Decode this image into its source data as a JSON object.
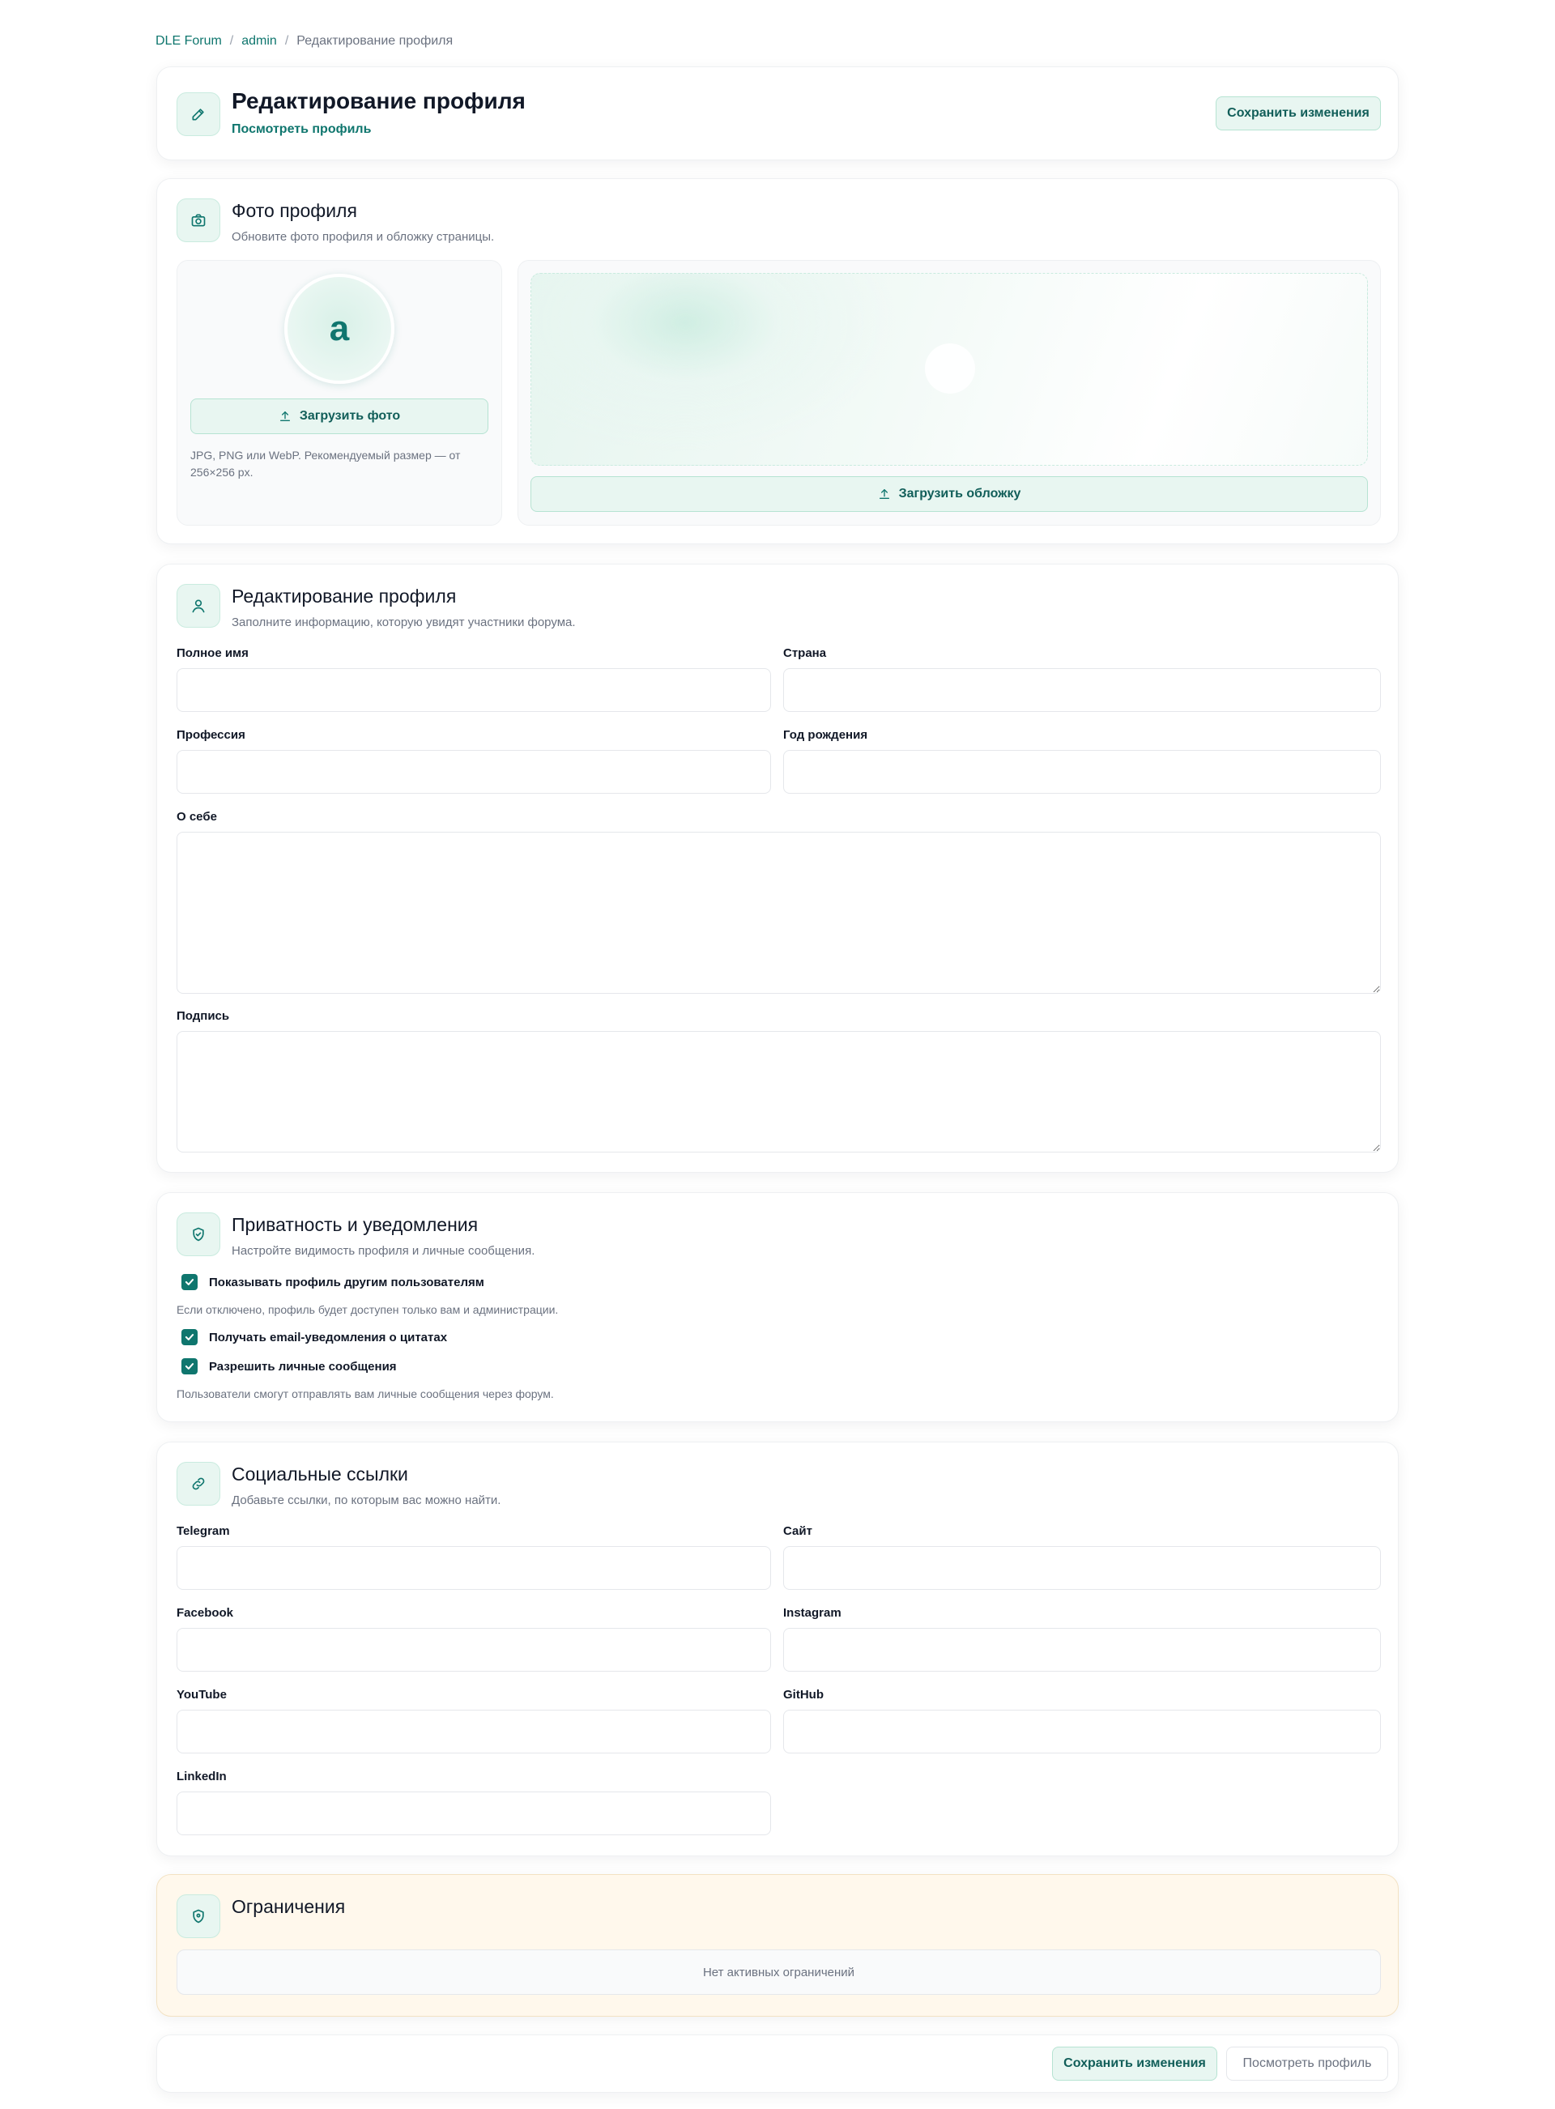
{
  "breadcrumb": {
    "items": [
      "DLE Forum",
      "admin",
      "Редактирование профиля"
    ],
    "separator": "/"
  },
  "header": {
    "title": "Редактирование профиля",
    "view_link": "Посмотреть профиль",
    "save_label": "Сохранить изменения"
  },
  "photo": {
    "title": "Фото профиля",
    "subtitle": "Обновите фото профиля и обложку страницы.",
    "avatar_letter": "a",
    "upload_photo_label": "Загрузить фото",
    "hint": "JPG, PNG или WebP. Рекомендуемый размер — от 256×256 px.",
    "upload_cover_label": "Загрузить обложку"
  },
  "profile": {
    "title": "Редактирование профиля",
    "subtitle": "Заполните информацию, которую увидят участники форума.",
    "full_name_label": "Полное имя",
    "country_label": "Страна",
    "profession_label": "Профессия",
    "birth_year_label": "Год рождения",
    "about_label": "О себе",
    "signature_label": "Подпись",
    "full_name": "",
    "country": "",
    "profession": "",
    "birth_year": "",
    "about": "",
    "signature": ""
  },
  "privacy": {
    "title": "Приватность и уведомления",
    "subtitle": "Настройте видимость профиля и личные сообщения.",
    "show_profile_label": "Показывать профиль другим пользователям",
    "show_profile_checked": true,
    "show_profile_hint": "Если отключено, профиль будет доступен только вам и администрации.",
    "email_notify_label": "Получать email-уведомления о цитатах",
    "email_notify_checked": true,
    "pm_label": "Разрешить личные сообщения",
    "pm_checked": true,
    "pm_hint": "Пользователи смогут отправлять вам личные сообщения через форум."
  },
  "social": {
    "title": "Социальные ссылки",
    "subtitle": "Добавьте ссылки, по которым вас можно найти.",
    "telegram_label": "Telegram",
    "site_label": "Сайт",
    "facebook_label": "Facebook",
    "instagram_label": "Instagram",
    "youtube_label": "YouTube",
    "github_label": "GitHub",
    "linkedin_label": "LinkedIn"
  },
  "restrictions": {
    "title": "Ограничения",
    "empty_text": "Нет активных ограничений"
  },
  "footer": {
    "save_label": "Сохранить изменения",
    "view_label": "Посмотреть профиль"
  },
  "colors": {
    "accent": "#0f766e",
    "accent_bg": "#e8f6f1",
    "warning_bg": "#fff8ec"
  },
  "icons": {
    "header": "pencil-icon",
    "photo": "camera-icon",
    "profile": "user-icon",
    "privacy": "shield-icon",
    "social": "link-icon",
    "restrictions": "shield-icon",
    "upload": "upload-icon"
  }
}
